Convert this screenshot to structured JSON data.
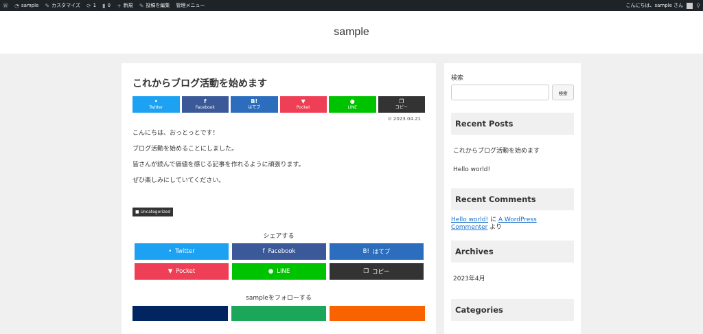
{
  "adminbar": {
    "site_name": "sample",
    "customize": "カスタマイズ",
    "updates_count": "1",
    "comments_count": "0",
    "new": "新規",
    "edit_post": "投稿を編集",
    "admin_menu": "管理メニュー",
    "greeting": "こんにちは、sample さん"
  },
  "header": {
    "site_title": "sample"
  },
  "post": {
    "title": "これからブログ活動を始めます",
    "sns_top": [
      "Twitter",
      "Facebook",
      "はてブ",
      "Pocket",
      "LINE",
      "コピー"
    ],
    "sns_top_icons": [
      "•",
      "f",
      "B!",
      "▼",
      "●",
      "❐"
    ],
    "date": "2023.04.21",
    "paragraphs": [
      "こんにちは、おっとっとです！",
      "ブログ活動を始めることにしました。",
      "皆さんが読んで価値を感じる記事を作れるように頑張ります。",
      "ぜひ楽しみにしていてください。"
    ],
    "category": "Uncategorized",
    "share_label": "シェアする",
    "share_buttons": [
      "Twitter",
      "Facebook",
      "はてブ",
      "Pocket",
      "LINE",
      "コピー"
    ],
    "share_icons": [
      "•",
      "f",
      "B!",
      "▼",
      "●",
      "❐"
    ],
    "follow_label": "sampleをフォローする"
  },
  "sidebar": {
    "search_label": "検索",
    "search_button": "検索",
    "recent_posts_title": "Recent Posts",
    "recent_posts": [
      "これからブログ活動を始めます",
      "Hello world!"
    ],
    "recent_comments_title": "Recent Comments",
    "comment": {
      "post_link": "Hello world!",
      "ni": "に",
      "author_link": "A WordPress Commenter",
      "yori": "より"
    },
    "archives_title": "Archives",
    "archives": [
      "2023年4月"
    ],
    "categories_title": "Categories"
  },
  "colors": {
    "twitter": "#1da1f2",
    "facebook": "#3b5998",
    "hatebu": "#2c6ebd",
    "pocket": "#ef3f56",
    "line": "#00c300",
    "copy": "#333333",
    "follow1": "#002561",
    "follow2": "#1ba659",
    "follow3": "#f86300"
  }
}
